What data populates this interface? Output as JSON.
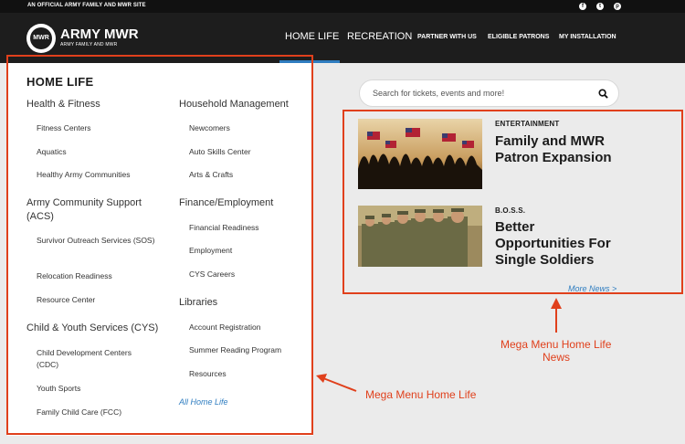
{
  "topbar": {
    "official_text": "AN OFFICIAL ARMY FAMILY AND MWR SITE",
    "social_icons": [
      "facebook-icon",
      "twitter-icon",
      "pinterest-icon"
    ]
  },
  "header": {
    "logo_badge": "MWR",
    "logo_text": "ARMY MWR",
    "logo_sub": "ARMY FAMILY AND MWR",
    "nav": [
      "HOME LIFE",
      "RECREATION",
      "PARTNER WITH US",
      "ELIGIBLE PATRONS",
      "MY INSTALLATION"
    ],
    "active_nav": "HOME LIFE",
    "accent_color": "#2f7dc0"
  },
  "menu": {
    "title": "HOME LIFE",
    "left_column": [
      {
        "category": "Health & Fitness",
        "items": [
          "Fitness Centers",
          "Aquatics",
          "Healthy Army Communities"
        ]
      },
      {
        "category": "Army Community Support (ACS)",
        "items": [
          "Survivor Outreach Services (SOS)",
          "Relocation Readiness",
          "Resource Center"
        ]
      },
      {
        "category": "Child & Youth Services (CYS)",
        "items": [
          "Child Development Centers (CDC)",
          "Youth Sports",
          "Family Child Care (FCC)"
        ]
      }
    ],
    "right_column": [
      {
        "category": "Household Management",
        "items": [
          "Newcomers",
          "Auto Skills Center",
          "Arts & Crafts"
        ]
      },
      {
        "category": "Finance/Employment",
        "items": [
          "Financial Readiness",
          "Employment",
          "CYS Careers"
        ]
      },
      {
        "category": "Libraries",
        "items": [
          "Account Registration",
          "Summer Reading Program",
          "Resources"
        ]
      }
    ],
    "all_link": "All Home Life"
  },
  "search": {
    "placeholder": "Search for tickets, events and more!",
    "icon": "search-icon"
  },
  "news": [
    {
      "category": "ENTERTAINMENT",
      "title_lines": [
        "Family and MWR",
        "Patron Expansion"
      ],
      "image": "crowd-waving-flags"
    },
    {
      "category": "B.O.S.S.",
      "title_lines": [
        "Better",
        "Opportunities For",
        "Single Soldiers"
      ],
      "image": "soldiers-in-uniform"
    }
  ],
  "more_news": "More News >",
  "annotations": {
    "menu": "Mega Menu Home Life",
    "news_lines": [
      "Mega Menu Home Life",
      "News"
    ],
    "color": "#e0401c"
  }
}
